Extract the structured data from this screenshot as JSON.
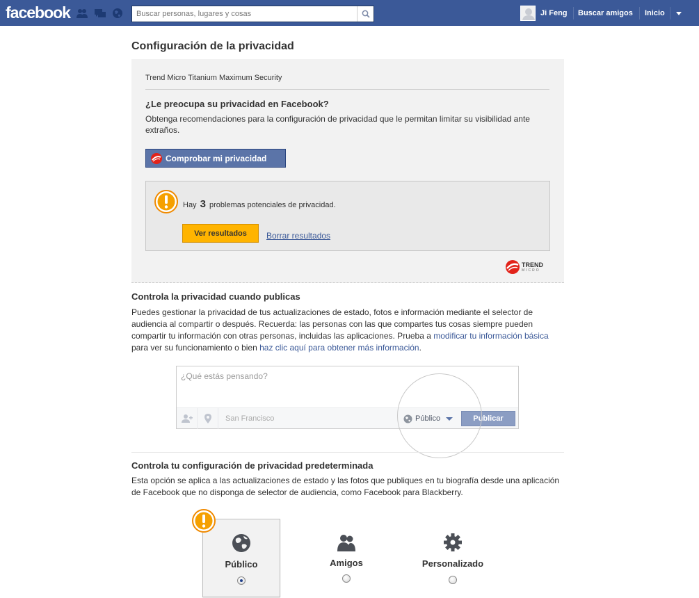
{
  "topbar": {
    "logo": "facebook",
    "search_placeholder": "Buscar personas, lugares y cosas",
    "user_name": "Ji Feng",
    "find_friends": "Buscar amigos",
    "home": "Inicio"
  },
  "page": {
    "title": "Configuración de la privacidad"
  },
  "trend_micro": {
    "header": "Trend Micro Titanium Maximum Security",
    "question": "¿Le preocupa su privacidad en Facebook?",
    "description": "Obtenga recomendaciones para la configuración de privacidad que le permitan limitar su visibilidad ante extraños.",
    "check_button": "Comprobar mi privacidad",
    "issue_prefix": "Hay",
    "issue_count": "3",
    "issue_suffix": "problemas potenciales de privacidad.",
    "see_results": "Ver resultados",
    "clear_results": "Borrar resultados",
    "logo_text": "TREND",
    "logo_sub": "MICRO"
  },
  "publish_section": {
    "title": "Controla la privacidad cuando publicas",
    "text_1": "Puedes gestionar la privacidad de tus actualizaciones de estado, fotos e información mediante el selector de audiencia al compartir o después. Recuerda: las personas con las que compartes tus cosas siempre pueden compartir tu información con otras personas, incluidas las aplicaciones. Prueba a ",
    "link_1": "modificar tu información básica",
    "text_2": " para ver su funcionamiento o bien ",
    "link_2": "haz clic aquí para obtener más información",
    "text_3": ".",
    "composer_placeholder": "¿Qué estás pensando?",
    "location": "San Francisco",
    "audience": "Público",
    "post_button": "Publicar"
  },
  "default_section": {
    "title": "Controla tu configuración de privacidad predeterminada",
    "text": "Esta opción se aplica a las actualizaciones de estado y las fotos que publiques en tu biografía desde una aplicación de Facebook que no disponga de selector de audiencia, como Facebook para Blackberry.",
    "options": [
      {
        "label": "Público",
        "icon": "globe-icon",
        "selected": true
      },
      {
        "label": "Amigos",
        "icon": "friends-icon",
        "selected": false
      },
      {
        "label": "Personalizado",
        "icon": "gear-icon",
        "selected": false
      }
    ]
  },
  "colors": {
    "brand_blue": "#3b5998",
    "button_blue": "#5b74a8",
    "warning_orange": "#f5a000",
    "results_yellow": "#ffb400"
  }
}
